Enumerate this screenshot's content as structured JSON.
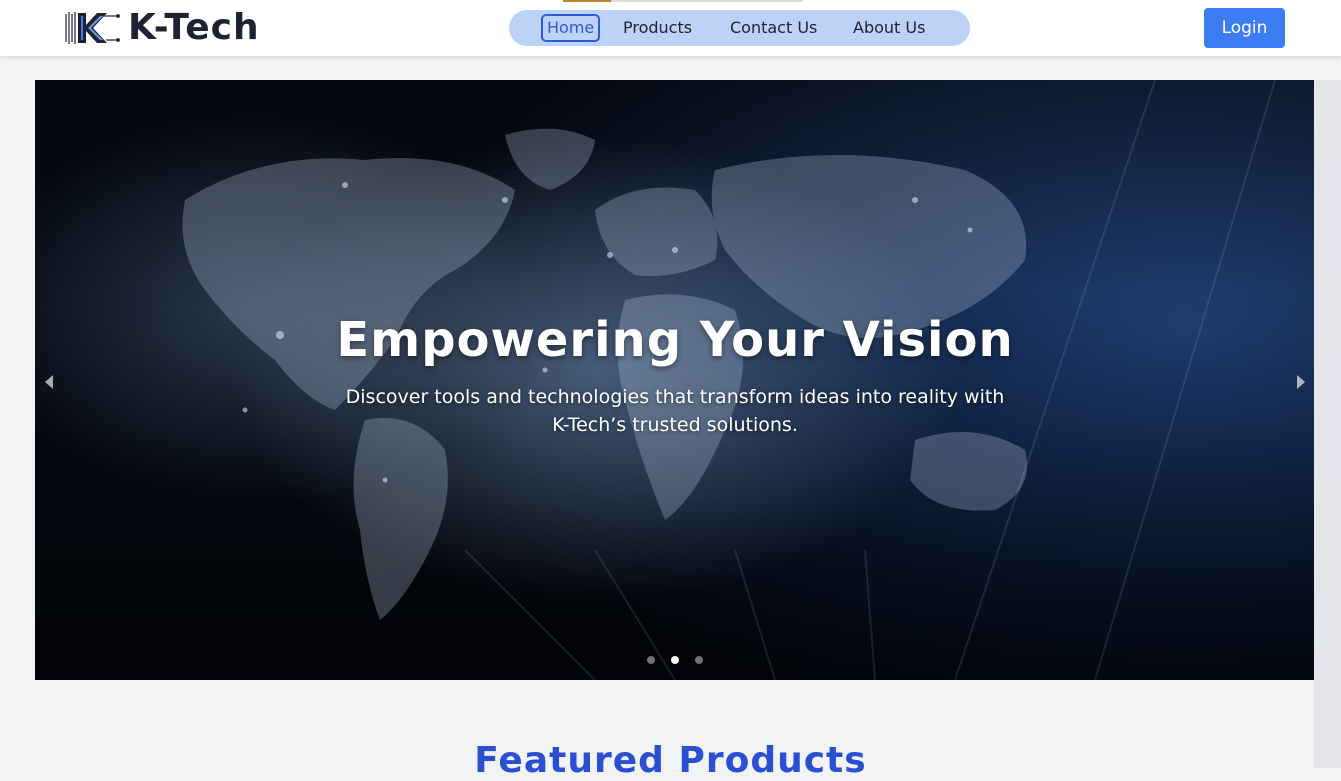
{
  "brand": {
    "name": "K-Tech",
    "logo_icon": "circuit-k-logo-icon"
  },
  "nav": {
    "items": [
      {
        "label": "Home",
        "active": true
      },
      {
        "label": "Products",
        "active": false
      },
      {
        "label": "Contact Us",
        "active": false
      },
      {
        "label": "About Us",
        "active": false
      }
    ]
  },
  "header": {
    "login_label": "Login"
  },
  "hero": {
    "title": "Empowering Your Vision",
    "subtitle": "Discover tools and technologies that transform ideas into reality with K-Tech’s trusted solutions.",
    "slides_total": 3,
    "active_slide": 2,
    "prev_icon": "caret-left-icon",
    "next_icon": "caret-right-icon"
  },
  "featured": {
    "title": "Featured Products"
  },
  "colors": {
    "accent": "#3b7cf2",
    "nav_pill": "#bcd3f7",
    "active_link": "#2e5bd6",
    "featured_title": "#2b4fd2",
    "text_dark": "#1f2233"
  }
}
